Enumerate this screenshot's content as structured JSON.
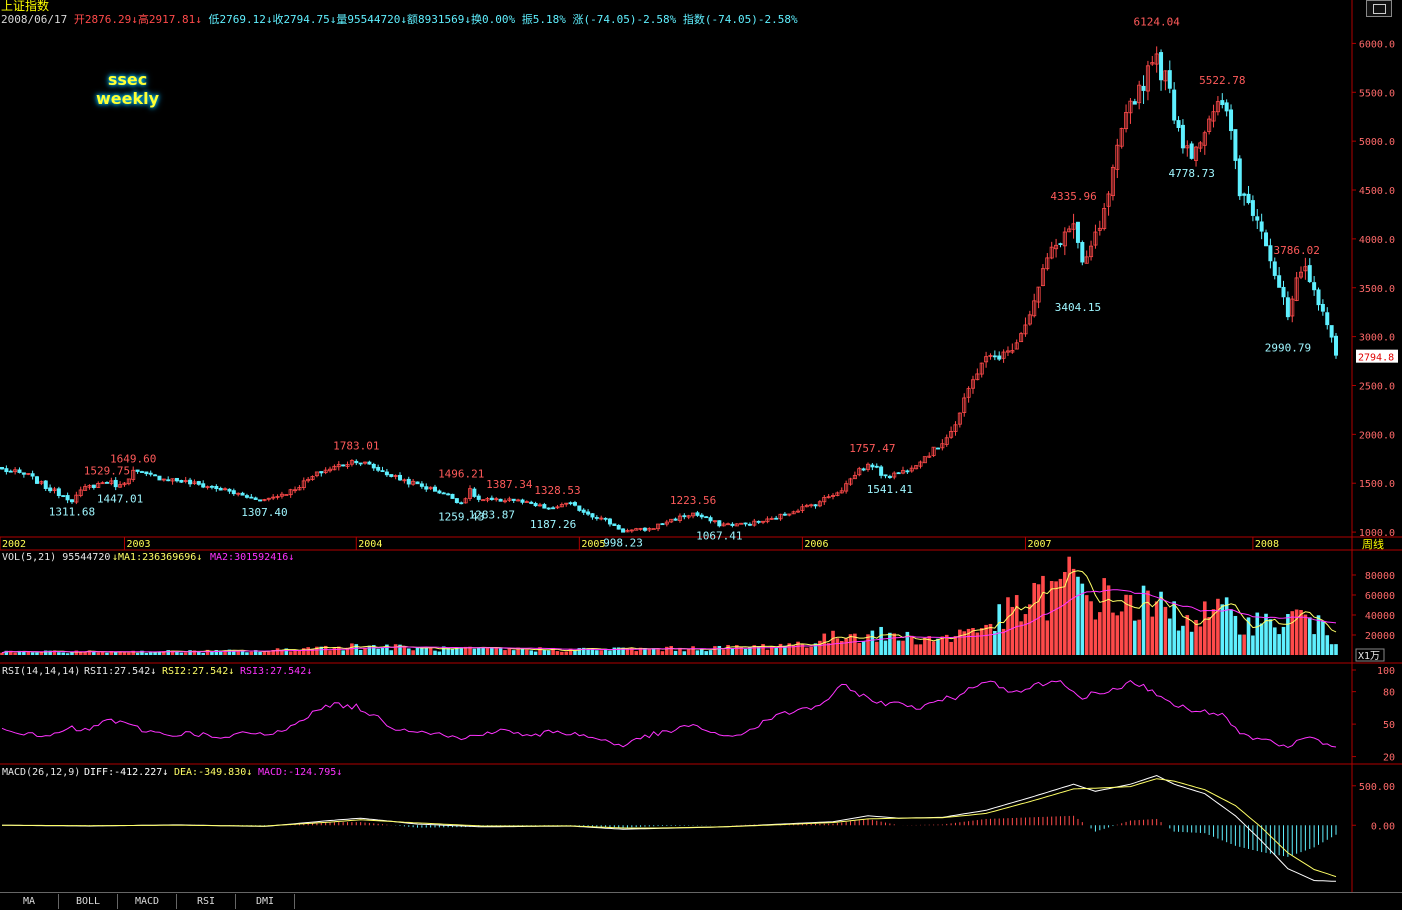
{
  "title": "上证指数",
  "info": {
    "date": "2008/06/17",
    "open_label": "开",
    "open": "2876.29",
    "high_label": "高",
    "high": "2917.81",
    "low_label": "低",
    "low": "2769.12",
    "close_label": "收",
    "close": "2794.75",
    "vol_label": "量",
    "vol": "95544720",
    "amount_label": "额",
    "amount": "8931569",
    "turnover_label": "换",
    "turnover": "0.00%",
    "amplitude_label": "振",
    "amplitude": "5.18%",
    "change_label": "涨",
    "change": "(-74.05)-2.58%",
    "index_label": "指数",
    "index_change": "(-74.05)-2.58%"
  },
  "watermark": {
    "line1": "ssec",
    "line2": "weekly"
  },
  "window_button_icon": "restore-window-icon",
  "period_button": "周线",
  "colors": {
    "up": "#ff4a4a",
    "down": "#5ff0ff",
    "ma1": "#ffff66",
    "ma2": "#ff33ff",
    "rsi": "#ff33ff",
    "diff": "#ffffff",
    "dea": "#ffff66",
    "axis": "#b00000",
    "label_up": "#ff5a5a",
    "label_down": "#9ff6ff"
  },
  "chart_data": {
    "type": "candlestick",
    "y_axis": {
      "ticks": [
        "1000.0",
        "1500.0",
        "2000.0",
        "2500.0",
        "3000.0",
        "3500.0",
        "4000.0",
        "4500.0",
        "5000.0",
        "5500.0",
        "6000.0"
      ],
      "range": [
        960,
        6260
      ]
    },
    "x_axis": {
      "year_labels": [
        {
          "label": "2002",
          "week": 0
        },
        {
          "label": "2003",
          "week": 28
        },
        {
          "label": "2004",
          "week": 81
        },
        {
          "label": "2005",
          "week": 132
        },
        {
          "label": "2006",
          "week": 183
        },
        {
          "label": "2007",
          "week": 234
        },
        {
          "label": "2008",
          "week": 286
        }
      ]
    },
    "current_price": "2794.8",
    "annotations": [
      {
        "text": "1311.68",
        "week": 16,
        "value": 1311.68,
        "kind": "low"
      },
      {
        "text": "1529.75",
        "week": 24,
        "value": 1529.75,
        "kind": "high"
      },
      {
        "text": "1649.60",
        "week": 30,
        "value": 1649.6,
        "kind": "high"
      },
      {
        "text": "1447.01",
        "week": 27,
        "value": 1447.01,
        "kind": "low"
      },
      {
        "text": "1307.40",
        "week": 60,
        "value": 1307.4,
        "kind": "low"
      },
      {
        "text": "1783.01",
        "week": 81,
        "value": 1783.01,
        "kind": "high"
      },
      {
        "text": "1496.21",
        "week": 105,
        "value": 1496.21,
        "kind": "high"
      },
      {
        "text": "1259.43",
        "week": 105,
        "value": 1259.43,
        "kind": "low"
      },
      {
        "text": "1387.34",
        "week": 116,
        "value": 1387.34,
        "kind": "high"
      },
      {
        "text": "1283.87",
        "week": 112,
        "value": 1283.87,
        "kind": "low"
      },
      {
        "text": "1328.53",
        "week": 127,
        "value": 1328.53,
        "kind": "high"
      },
      {
        "text": "1187.26",
        "week": 126,
        "value": 1187.26,
        "kind": "low"
      },
      {
        "text": "998.23",
        "week": 142,
        "value": 998.23,
        "kind": "low"
      },
      {
        "text": "1223.56",
        "week": 158,
        "value": 1223.56,
        "kind": "high"
      },
      {
        "text": "1067.41",
        "week": 164,
        "value": 1067.41,
        "kind": "low"
      },
      {
        "text": "1757.47",
        "week": 199,
        "value": 1757.47,
        "kind": "high"
      },
      {
        "text": "1541.41",
        "week": 203,
        "value": 1541.41,
        "kind": "low"
      },
      {
        "text": "4335.96",
        "week": 245,
        "value": 4335.96,
        "kind": "high"
      },
      {
        "text": "3404.15",
        "week": 246,
        "value": 3404.15,
        "kind": "low"
      },
      {
        "text": "6124.04",
        "week": 264,
        "value": 6124.04,
        "kind": "high"
      },
      {
        "text": "4778.73",
        "week": 272,
        "value": 4778.73,
        "kind": "low"
      },
      {
        "text": "5522.78",
        "week": 279,
        "value": 5522.78,
        "kind": "high"
      },
      {
        "text": "3786.02",
        "week": 296,
        "value": 3786.02,
        "kind": "high"
      },
      {
        "text": "2990.79",
        "week": 294,
        "value": 2990.79,
        "kind": "low"
      }
    ],
    "price_path": [
      [
        0,
        1640
      ],
      [
        6,
        1580
      ],
      [
        10,
        1460
      ],
      [
        16,
        1330
      ],
      [
        19,
        1450
      ],
      [
        24,
        1520
      ],
      [
        27,
        1470
      ],
      [
        30,
        1620
      ],
      [
        33,
        1580
      ],
      [
        40,
        1530
      ],
      [
        50,
        1440
      ],
      [
        56,
        1360
      ],
      [
        60,
        1330
      ],
      [
        66,
        1420
      ],
      [
        73,
        1620
      ],
      [
        81,
        1740
      ],
      [
        84,
        1680
      ],
      [
        90,
        1560
      ],
      [
        96,
        1470
      ],
      [
        101,
        1400
      ],
      [
        105,
        1300
      ],
      [
        107,
        1420
      ],
      [
        109,
        1330
      ],
      [
        113,
        1320
      ],
      [
        116,
        1340
      ],
      [
        121,
        1280
      ],
      [
        126,
        1230
      ],
      [
        128,
        1290
      ],
      [
        130,
        1280
      ],
      [
        134,
        1190
      ],
      [
        138,
        1120
      ],
      [
        142,
        1010
      ],
      [
        148,
        1030
      ],
      [
        152,
        1110
      ],
      [
        158,
        1190
      ],
      [
        164,
        1080
      ],
      [
        170,
        1080
      ],
      [
        176,
        1130
      ],
      [
        181,
        1220
      ],
      [
        186,
        1290
      ],
      [
        192,
        1440
      ],
      [
        196,
        1640
      ],
      [
        199,
        1690
      ],
      [
        201,
        1600
      ],
      [
        203,
        1580
      ],
      [
        206,
        1620
      ],
      [
        210,
        1740
      ],
      [
        214,
        1870
      ],
      [
        218,
        2100
      ],
      [
        221,
        2450
      ],
      [
        224,
        2750
      ],
      [
        227,
        2800
      ],
      [
        230,
        2830
      ],
      [
        233,
        3050
      ],
      [
        236,
        3350
      ],
      [
        239,
        3800
      ],
      [
        242,
        4000
      ],
      [
        245,
        4150
      ],
      [
        247,
        3700
      ],
      [
        249,
        3900
      ],
      [
        252,
        4250
      ],
      [
        255,
        4880
      ],
      [
        258,
        5400
      ],
      [
        261,
        5600
      ],
      [
        263,
        5900
      ],
      [
        264,
        5800
      ],
      [
        266,
        5650
      ],
      [
        268,
        5300
      ],
      [
        270,
        5000
      ],
      [
        272,
        4900
      ],
      [
        275,
        5100
      ],
      [
        277,
        5250
      ],
      [
        279,
        5400
      ],
      [
        281,
        5100
      ],
      [
        283,
        4500
      ],
      [
        286,
        4300
      ],
      [
        288,
        4150
      ],
      [
        290,
        3800
      ],
      [
        292,
        3500
      ],
      [
        294,
        3200
      ],
      [
        296,
        3550
      ],
      [
        298,
        3660
      ],
      [
        300,
        3450
      ],
      [
        302,
        3300
      ],
      [
        304,
        2950
      ],
      [
        305,
        2795
      ]
    ],
    "volume": {
      "label": "VOL(5,21)",
      "value": "95544720",
      "ma1_label": "MA1:236369696",
      "ma2_label": "MA2:301592416",
      "ticks": [
        "20000",
        "40000",
        "60000",
        "80000"
      ],
      "unit": "X1万",
      "range": [
        0,
        95000
      ]
    },
    "volume_path": [
      [
        0,
        3000
      ],
      [
        40,
        3500
      ],
      [
        60,
        4000
      ],
      [
        75,
        8000
      ],
      [
        82,
        9000
      ],
      [
        100,
        6000
      ],
      [
        130,
        5500
      ],
      [
        150,
        6000
      ],
      [
        170,
        7500
      ],
      [
        185,
        12000
      ],
      [
        195,
        22000
      ],
      [
        205,
        18000
      ],
      [
        215,
        16000
      ],
      [
        225,
        30000
      ],
      [
        235,
        50000
      ],
      [
        245,
        75000
      ],
      [
        248,
        60000
      ],
      [
        255,
        52000
      ],
      [
        262,
        50000
      ],
      [
        270,
        38000
      ],
      [
        280,
        40000
      ],
      [
        290,
        30000
      ],
      [
        298,
        40000
      ],
      [
        305,
        12000
      ]
    ],
    "rsi": {
      "label": "RSI(14,14,14)",
      "rsi1": "RSI1:27.542",
      "rsi2": "RSI2:27.542",
      "rsi3": "RSI3:27.542",
      "ticks": [
        "20",
        "50",
        "80",
        "100"
      ],
      "range": [
        15,
        100
      ]
    },
    "rsi_path": [
      [
        0,
        48
      ],
      [
        6,
        40
      ],
      [
        10,
        38
      ],
      [
        16,
        46
      ],
      [
        20,
        44
      ],
      [
        24,
        55
      ],
      [
        28,
        50
      ],
      [
        32,
        45
      ],
      [
        38,
        40
      ],
      [
        44,
        42
      ],
      [
        50,
        36
      ],
      [
        56,
        42
      ],
      [
        62,
        40
      ],
      [
        70,
        58
      ],
      [
        75,
        68
      ],
      [
        81,
        66
      ],
      [
        85,
        58
      ],
      [
        90,
        46
      ],
      [
        96,
        44
      ],
      [
        101,
        40
      ],
      [
        105,
        36
      ],
      [
        110,
        42
      ],
      [
        116,
        44
      ],
      [
        121,
        38
      ],
      [
        126,
        44
      ],
      [
        132,
        40
      ],
      [
        138,
        35
      ],
      [
        142,
        30
      ],
      [
        148,
        40
      ],
      [
        152,
        42
      ],
      [
        158,
        50
      ],
      [
        164,
        38
      ],
      [
        170,
        42
      ],
      [
        176,
        56
      ],
      [
        181,
        62
      ],
      [
        186,
        66
      ],
      [
        190,
        76
      ],
      [
        192,
        86
      ],
      [
        195,
        80
      ],
      [
        199,
        72
      ],
      [
        203,
        68
      ],
      [
        206,
        70
      ],
      [
        210,
        64
      ],
      [
        214,
        72
      ],
      [
        218,
        75
      ],
      [
        221,
        82
      ],
      [
        224,
        90
      ],
      [
        227,
        88
      ],
      [
        230,
        82
      ],
      [
        233,
        80
      ],
      [
        236,
        86
      ],
      [
        239,
        88
      ],
      [
        242,
        90
      ],
      [
        245,
        82
      ],
      [
        247,
        72
      ],
      [
        249,
        78
      ],
      [
        252,
        76
      ],
      [
        255,
        84
      ],
      [
        258,
        88
      ],
      [
        261,
        85
      ],
      [
        263,
        80
      ],
      [
        266,
        74
      ],
      [
        268,
        67
      ],
      [
        270,
        66
      ],
      [
        272,
        60
      ],
      [
        275,
        64
      ],
      [
        277,
        58
      ],
      [
        279,
        60
      ],
      [
        281,
        50
      ],
      [
        283,
        40
      ],
      [
        286,
        36
      ],
      [
        288,
        36
      ],
      [
        290,
        34
      ],
      [
        292,
        30
      ],
      [
        294,
        27
      ],
      [
        296,
        34
      ],
      [
        298,
        38
      ],
      [
        300,
        36
      ],
      [
        302,
        33
      ],
      [
        305,
        27.5
      ]
    ],
    "macd": {
      "label": "MACD(26,12,9)",
      "diff_label": "DIFF:-412.227",
      "dea_label": "DEA:-349.830",
      "macd_label": "MACD:-124.795",
      "ticks": [
        "0.00",
        "500.00"
      ],
      "range": [
        -820,
        700
      ]
    },
    "diff_path": [
      [
        0,
        0
      ],
      [
        20,
        -10
      ],
      [
        40,
        5
      ],
      [
        60,
        -15
      ],
      [
        75,
        60
      ],
      [
        82,
        90
      ],
      [
        95,
        15
      ],
      [
        110,
        -20
      ],
      [
        130,
        -10
      ],
      [
        142,
        -50
      ],
      [
        150,
        -40
      ],
      [
        165,
        -20
      ],
      [
        180,
        20
      ],
      [
        190,
        45
      ],
      [
        198,
        120
      ],
      [
        205,
        90
      ],
      [
        215,
        100
      ],
      [
        225,
        190
      ],
      [
        235,
        350
      ],
      [
        245,
        520
      ],
      [
        250,
        430
      ],
      [
        258,
        520
      ],
      [
        264,
        630
      ],
      [
        268,
        520
      ],
      [
        275,
        400
      ],
      [
        282,
        120
      ],
      [
        288,
        -200
      ],
      [
        294,
        -550
      ],
      [
        300,
        -700
      ],
      [
        305,
        -710
      ]
    ],
    "dea_path": [
      [
        0,
        0
      ],
      [
        20,
        -5
      ],
      [
        40,
        0
      ],
      [
        60,
        -10
      ],
      [
        75,
        40
      ],
      [
        82,
        70
      ],
      [
        95,
        30
      ],
      [
        110,
        -10
      ],
      [
        130,
        -8
      ],
      [
        142,
        -35
      ],
      [
        150,
        -35
      ],
      [
        165,
        -20
      ],
      [
        180,
        12
      ],
      [
        190,
        35
      ],
      [
        198,
        80
      ],
      [
        205,
        90
      ],
      [
        215,
        95
      ],
      [
        225,
        150
      ],
      [
        235,
        300
      ],
      [
        245,
        460
      ],
      [
        250,
        470
      ],
      [
        258,
        490
      ],
      [
        264,
        590
      ],
      [
        268,
        560
      ],
      [
        275,
        450
      ],
      [
        282,
        250
      ],
      [
        288,
        -30
      ],
      [
        294,
        -350
      ],
      [
        300,
        -560
      ],
      [
        305,
        -650
      ]
    ]
  },
  "tabs": [
    "MA",
    "BOLL",
    "MACD",
    "RSI",
    "DMI"
  ]
}
